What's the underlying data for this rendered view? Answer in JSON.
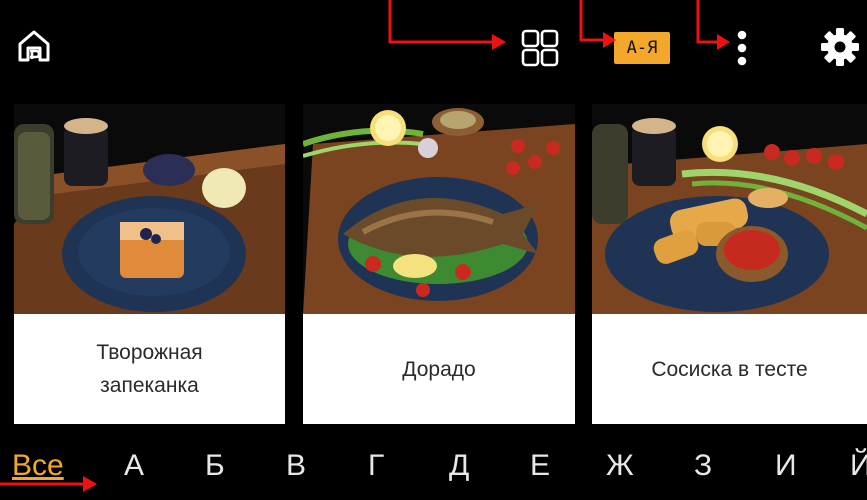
{
  "toolbar": {
    "home_icon": "home-icon",
    "grid_icon": "grid-view-icon",
    "sort_label": "А-Я",
    "more_icon": "more-vertical-icon",
    "settings_icon": "gear-icon",
    "accent_color": "#f3a72b"
  },
  "cards": [
    {
      "title_line1": "Творожная",
      "title_line2": "запеканка"
    },
    {
      "title": "Дорадо"
    },
    {
      "title": "Сосиска в тесте"
    }
  ],
  "alphabet": {
    "active": "Все",
    "letters": [
      "А",
      "Б",
      "В",
      "Г",
      "Д",
      "Е",
      "Ж",
      "З",
      "И",
      "Й"
    ]
  }
}
